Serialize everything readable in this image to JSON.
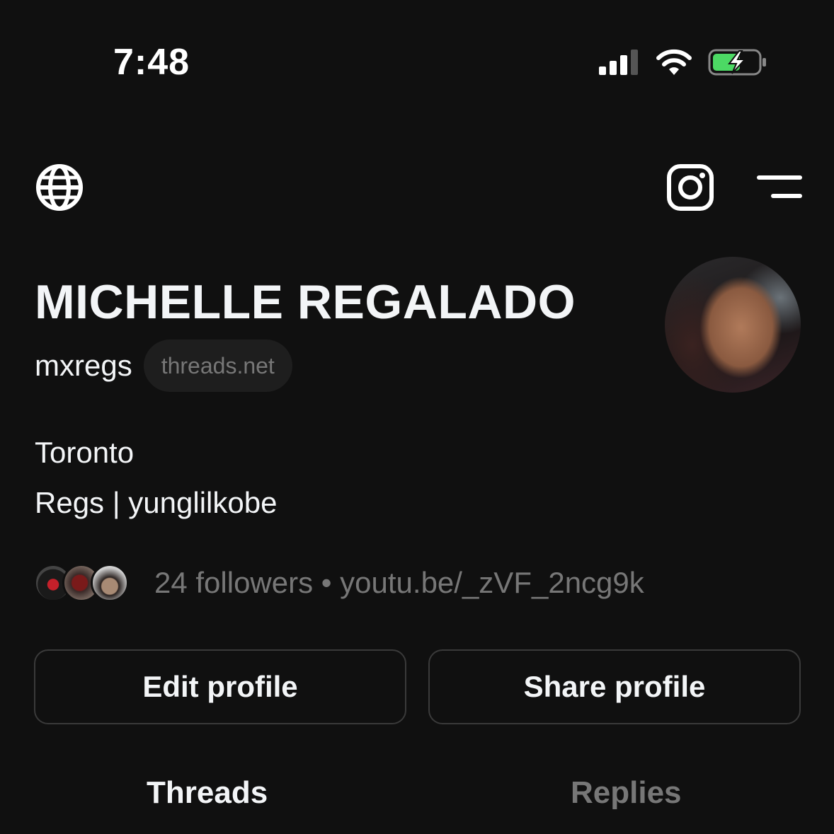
{
  "status_bar": {
    "time": "7:48",
    "icons": [
      "signal-icon",
      "wifi-icon",
      "battery-charging-icon"
    ],
    "battery_color": "#4cd964"
  },
  "top_bar": {
    "left_icon": "globe-icon",
    "right_icons": [
      "instagram-icon",
      "menu-icon"
    ]
  },
  "profile": {
    "display_name": "MICHELLE REGALADO",
    "username": "mxregs",
    "domain_chip": "threads.net",
    "bio": [
      "Toronto",
      "Regs | yunglilkobe"
    ],
    "followers_text": "24 followers • youtu.be/_zVF_2ncg9k"
  },
  "actions": {
    "edit_label": "Edit profile",
    "share_label": "Share profile"
  },
  "tabs": [
    {
      "label": "Threads",
      "active": true
    },
    {
      "label": "Replies",
      "active": false
    }
  ],
  "colors": {
    "background": "#101010",
    "text_primary": "#f3f5f7",
    "text_secondary": "#777777",
    "border": "#3a3a3a"
  }
}
